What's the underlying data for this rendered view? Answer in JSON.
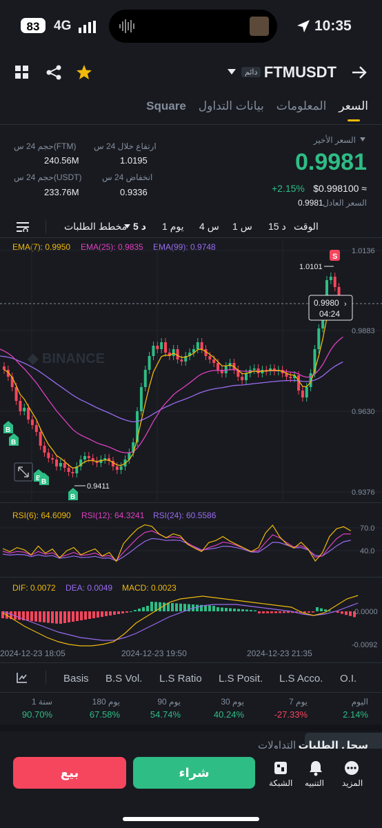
{
  "status": {
    "battery": "83",
    "network": "4G",
    "time": "10:35"
  },
  "header": {
    "symbol": "FTMUSDT",
    "badge": "دائم"
  },
  "tabs": [
    {
      "label": "السعر",
      "active": true
    },
    {
      "label": "المعلومات",
      "active": false
    },
    {
      "label": "بيانات التداول",
      "active": false
    },
    {
      "label": "Square",
      "active": false
    }
  ],
  "price": {
    "last_label": "السعر الأخير",
    "last": "0.9981",
    "change": "+2.15%",
    "usd": "$0.998100 ≈",
    "fair_label": "السعر العادل",
    "fair": "0.9981"
  },
  "stats": {
    "high_label": "ارتفاع خلال 24 س",
    "high": "1.0195",
    "low_label": "انخفاض 24 س",
    "low": "0.9336",
    "vol_ftm_label": "حجم 24 س(FTM)",
    "vol_ftm": "240.56M",
    "vol_usdt_label": "حجم 24 س(USDT)",
    "vol_usdt": "233.76M"
  },
  "timeframes": {
    "time_label": "الوقت",
    "m15": "15 د",
    "h1": "1 س",
    "h4": "4 س",
    "d1": "1 يوم",
    "m5": "5 د",
    "depth": "مخطط الطلبات"
  },
  "ema": {
    "ema7": "EMA(7): 0.9950",
    "ema25": "EMA(25): 0.9835",
    "ema99": "EMA(99): 0.9748"
  },
  "rsi": {
    "rsi6": "RSI(6): 64.6090",
    "rsi12": "RSI(12): 64.3241",
    "rsi24": "RSI(24): 60.5586",
    "l70": "70.0",
    "l40": "40.0"
  },
  "macd": {
    "dif": "DIF: 0.0072",
    "dea": "DEA: 0.0049",
    "macd": "MACD: 0.0023",
    "zero": "0.0000",
    "neg": "-0.0092"
  },
  "axis": {
    "p1": "1.0136",
    "p2": "0.9883",
    "p3": "0.9630",
    "p4": "0.9376"
  },
  "markers": {
    "high": "1.0101",
    "low": "0.9411",
    "cur_price": "0.9980",
    "countdown": "04:24",
    "sell": "S",
    "buy": "B"
  },
  "dates": [
    "2024-12-23 18:05",
    "2024-12-23 19:50",
    "2024-12-23 21:35"
  ],
  "indicators": [
    "Basis",
    "B.S Vol.",
    "L.S Ratio",
    "L.S Posit.",
    "L.S Acco.",
    "O.I."
  ],
  "performance": [
    {
      "label": "اليوم",
      "value": "2.14%",
      "color": "#2ebd85"
    },
    {
      "label": "7 يوم",
      "value": "-27.33%",
      "color": "#f6465d"
    },
    {
      "label": "30 يوم",
      "value": "40.24%",
      "color": "#2ebd85"
    },
    {
      "label": "90 يوم",
      "value": "54.74%",
      "color": "#2ebd85"
    },
    {
      "label": "180 يوم",
      "value": "67.58%",
      "color": "#2ebd85"
    },
    {
      "label": "1 سنة",
      "value": "90.70%",
      "color": "#2ebd85"
    }
  ],
  "lower_tabs": {
    "orderbook": "سجل الطلبات",
    "trades": "التداولات"
  },
  "bottom": {
    "more": "المزيد",
    "alerts": "التنبيه",
    "grid": "الشبكة",
    "buy": "شراء",
    "sell": "بيع"
  },
  "colors": {
    "up": "#2ebd85",
    "down": "#f6465d",
    "accent": "#f0b90b",
    "ema7": "#f0b90b",
    "ema25": "#e040c0",
    "ema99": "#9b6cf0"
  }
}
